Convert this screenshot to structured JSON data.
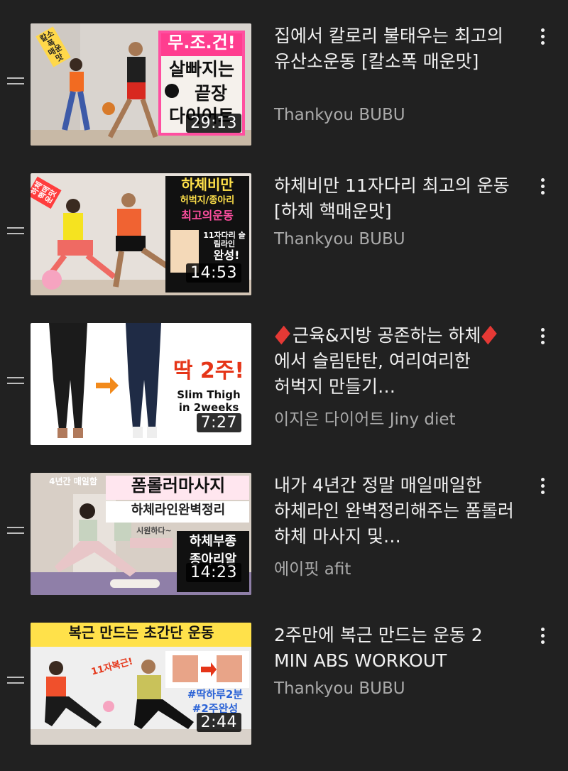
{
  "videos": [
    {
      "title": "집에서 칼로리 불태우는 최고의 유산소운동 [칼소폭 매운맛]",
      "channel": "Thankyou BUBU",
      "duration": "29:13",
      "thumb_text": [
        "칼소폭 매운맛",
        "무.조.건!",
        "살빠지는",
        "끝장",
        "다이어트"
      ]
    },
    {
      "title": "하체비만 11자다리 최고의 운동 [하체 핵매운맛]",
      "channel": "Thankyou BUBU",
      "duration": "14:53",
      "thumb_text": [
        "하체 핵매운맛",
        "하체비만",
        "허벅지/종아리",
        "최고의운동",
        "11자다리 슬림라인",
        "완성!"
      ]
    },
    {
      "title_parts": [
        "근육&지방 공존하는 하체",
        "에서 슬림탄탄, 여리여리한 허벅지 만들기…"
      ],
      "channel": "이지은 다이어트 Jiny diet",
      "duration": "7:27",
      "thumb_text": [
        "딱 2주!",
        "Slim Thigh",
        "in 2weeks"
      ]
    },
    {
      "title": "내가 4년간 정말 매일매일한 하체라인 완벽정리해주는 폼롤러 하체 마사지 및…",
      "channel": "에이핏 afit",
      "duration": "14:23",
      "thumb_text": [
        "4년간 매일함",
        "폼롤러마사지",
        "하체라인완벽정리",
        "시원하다~",
        "하체부종",
        "종아리알"
      ]
    },
    {
      "title": "2주만에 복근 만드는 운동 2 MIN ABS WORKOUT",
      "channel": "Thankyou BUBU",
      "duration": "2:44",
      "thumb_text": [
        "복근 만드는 초간단 운동",
        "11자복근!",
        "#딱하루2분",
        "#2주완성"
      ]
    }
  ],
  "colors": {
    "background": "#212121",
    "title": "#f1f1f1",
    "channel": "#aaaaaa",
    "gem": "#e53935"
  },
  "icons": {
    "drag": "drag-handle-icon",
    "menu": "more-vert-icon",
    "gem": "red-diamond-icon"
  }
}
